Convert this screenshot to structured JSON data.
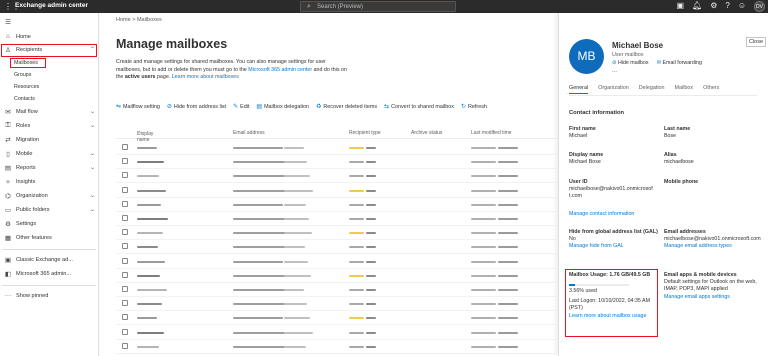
{
  "topbar": {
    "app_title": "Exchange admin center",
    "search_placeholder": "Search (Preview)",
    "avatar_initials": "DV",
    "icons": [
      "grid-icon",
      "search-icon",
      "notification-icon",
      "settings-icon",
      "help-icon",
      "feedback-icon"
    ]
  },
  "sidebar": {
    "home": "Home",
    "recipients": "Recipients",
    "sub_items": [
      "Mailboxes",
      "Groups",
      "Resources",
      "Contacts"
    ],
    "items": [
      "Mail flow",
      "Roles",
      "Migration",
      "Mobile",
      "Reports",
      "Insights",
      "Organization",
      "Public folders",
      "Settings",
      "Other features"
    ],
    "classic": "Classic Exchange ad...",
    "m365": "Microsoft 365 admin...",
    "show_pinned": "Show pinned"
  },
  "main": {
    "breadcrumb_home": "Home",
    "breadcrumb_sep": ">",
    "breadcrumb_current": "Mailboxes",
    "title": "Manage mailboxes",
    "desc_part1": "Create and manage settings for shared mailboxes. You can also manage settings for user mailboxes, but to add or delete them you must go to the",
    "desc_link1": "Microsoft 365 admin center",
    "desc_part2": "and do this on the",
    "desc_bold": "active users",
    "desc_part3": "page.",
    "desc_link2": "Learn more about mailboxes",
    "commands": [
      "Mailflow setting",
      "Hide from address list",
      "Edit",
      "Mailbox delegation",
      "Recover deleted items",
      "Convert to shared mailbox",
      "Refresh"
    ],
    "columns": [
      "Display name",
      "Email address",
      "Recipient type",
      "Archive status",
      "Last modified time"
    ],
    "sort_indicator": "↑"
  },
  "panel": {
    "close_label": "Close",
    "avatar_initials": "MB",
    "name": "Michael Bose",
    "type": "User mailbox",
    "action_hide": "Hide mailbox",
    "action_forward": "Email forwarding",
    "more": "...",
    "tabs": [
      "General",
      "Organization",
      "Delegation",
      "Mailbox",
      "Others"
    ],
    "contact_info_title": "Contact information",
    "first_name_label": "First name",
    "first_name": "Michael",
    "last_name_label": "Last name",
    "last_name": "Bose",
    "display_name_label": "Display name",
    "display_name": "Michael Bose",
    "alias_label": "Alias",
    "alias": "michaelbose",
    "user_id_label": "User ID",
    "user_id": "michaelbose@nakivo01.onmicrosoft.com",
    "mobile_label": "Mobile phone",
    "manage_contact": "Manage contact information",
    "hide_gal_label": "Hide from global address list (GAL)",
    "hide_gal_value": "No",
    "manage_gal": "Manage hide from GAL",
    "email_addr_label": "Email addresses",
    "email_addr_value": "michaelbose@nakivo01.onmicrosoft.com",
    "manage_email": "Manage email address types",
    "usage_label": "Mailbox Usage: 1.76 GB/49.5 GB",
    "usage_fraction": 0.0356,
    "usage_pct": "3.56% used",
    "last_logon": "Last Logon: 10/10/2022, 04:35 AM (PST)",
    "learn_usage": "Learn more about mailbox usage",
    "apps_label": "Email apps & mobile devices",
    "apps_value": "Default settings for Outlook on the web, IMAP, POP3, MAPI applied",
    "manage_apps": "Manage email apps settings"
  },
  "colors": {
    "accent": "#0078d4",
    "highlight": "#e81123",
    "avatar": "#0f6cbd"
  }
}
